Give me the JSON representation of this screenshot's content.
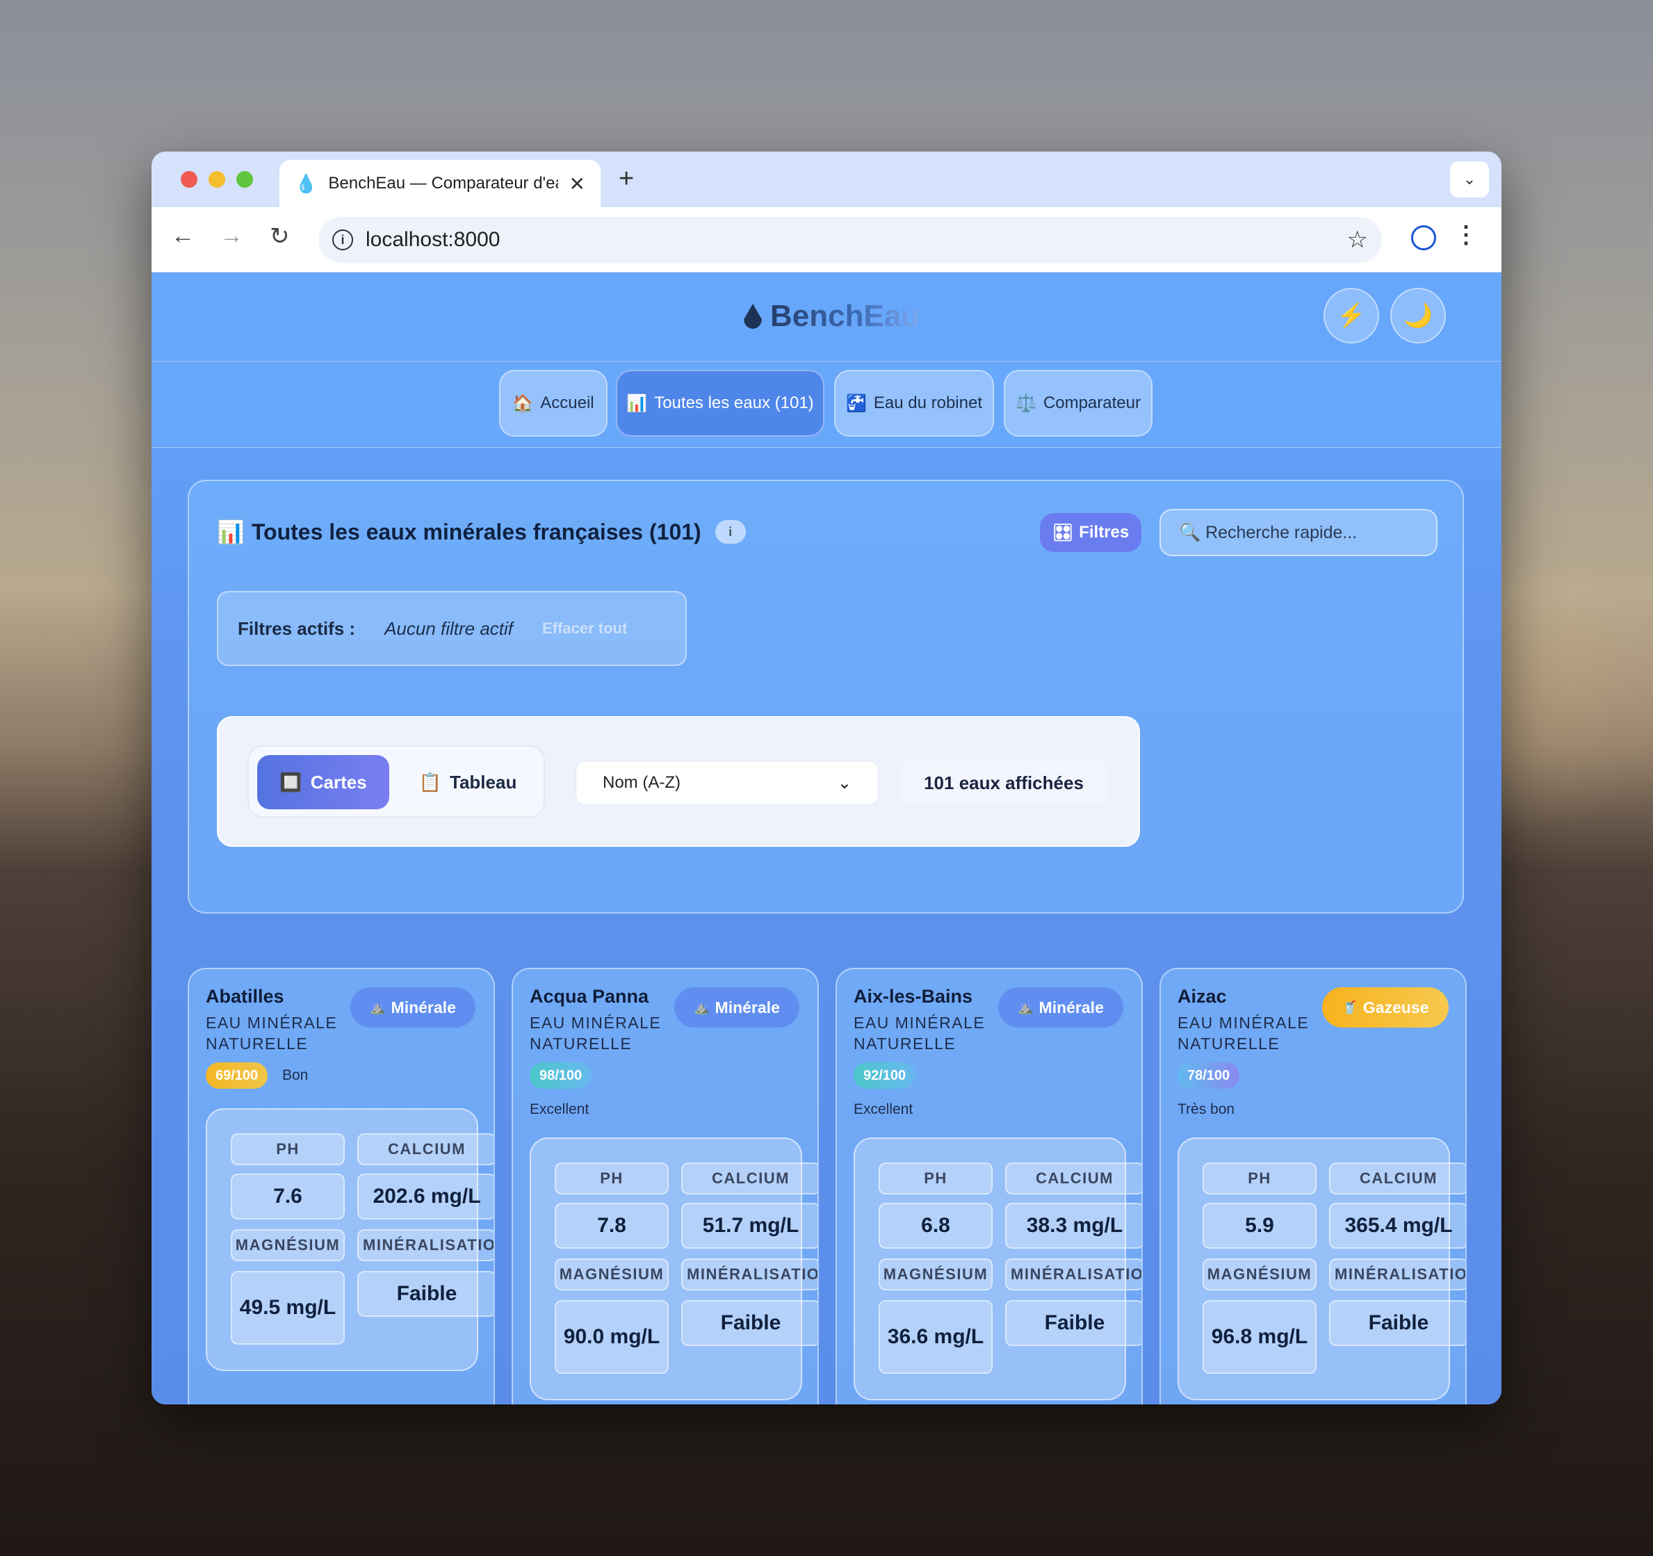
{
  "browser": {
    "tab_title": "BenchEau — Comparateur d'eaux",
    "tab_icon": "water-drop-icon",
    "url": "localhost:8000"
  },
  "header": {
    "brand": "BenchEau",
    "quick_button_icon": "⚡",
    "theme_button_icon": "🌙"
  },
  "nav": {
    "tabs": [
      {
        "icon": "🏠",
        "label": "Accueil"
      },
      {
        "icon": "📊",
        "label": "Toutes les eaux (101)"
      },
      {
        "icon": "🚰",
        "label": "Eau du robinet"
      },
      {
        "icon": "⚖️",
        "label": "Comparateur"
      }
    ],
    "active_index": 1
  },
  "panel": {
    "title_icon": "📊",
    "title": "Toutes les eaux minérales françaises (101)",
    "info_icon": "i",
    "filters_icon": "🎛",
    "filters_label": "Filtres",
    "search_placeholder": "🔍 Recherche rapide...",
    "active_filters_label": "Filtres actifs :",
    "active_filters_value": "Aucun filtre actif",
    "clear_label": "Effacer tout",
    "view_cards_icon": "🔲",
    "view_cards_label": "Cartes",
    "view_table_icon": "📋",
    "view_table_label": "Tableau",
    "sort_value": "Nom (A-Z)",
    "count_label": "101 eaux affichées"
  },
  "cards": [
    {
      "name": "Abatilles",
      "type": "EAU MINÉRALE NATURELLE",
      "badge_icon": "⛰️",
      "badge": "Minérale",
      "badge_kind": "min",
      "score": "69/100",
      "score_label": "Bon",
      "score_kind": "bon",
      "ph_label": "PH",
      "ph": "7.6",
      "calcium_label": "CALCIUM",
      "calcium": "202.6 mg/L",
      "magnesium_label": "MAGNÉSIUM",
      "magnesium": "49.5 mg/L",
      "mineral_label": "MINÉRALISATION",
      "mineral": "Faible"
    },
    {
      "name": "Acqua Panna",
      "type": "EAU MINÉRALE NATURELLE",
      "badge_icon": "⛰️",
      "badge": "Minérale",
      "badge_kind": "min",
      "score": "98/100",
      "score_label": "Excellent",
      "score_kind": "exc",
      "ph_label": "PH",
      "ph": "7.8",
      "calcium_label": "CALCIUM",
      "calcium": "51.7 mg/L",
      "magnesium_label": "MAGNÉSIUM",
      "magnesium": "90.0 mg/L",
      "mineral_label": "MINÉRALISATION",
      "mineral": "Faible"
    },
    {
      "name": "Aix-les-Bains",
      "type": "EAU MINÉRALE NATURELLE",
      "badge_icon": "⛰️",
      "badge": "Minérale",
      "badge_kind": "min",
      "score": "92/100",
      "score_label": "Excellent",
      "score_kind": "exc",
      "ph_label": "PH",
      "ph": "6.8",
      "calcium_label": "CALCIUM",
      "calcium": "38.3 mg/L",
      "magnesium_label": "MAGNÉSIUM",
      "magnesium": "36.6 mg/L",
      "mineral_label": "MINÉRALISATION",
      "mineral": "Faible"
    },
    {
      "name": "Aizac",
      "type": "EAU MINÉRALE NATURELLE",
      "badge_icon": "🥤",
      "badge": "Gazeuse",
      "badge_kind": "gaz",
      "score": "78/100",
      "score_label": "Très bon",
      "score_kind": "tb",
      "ph_label": "PH",
      "ph": "5.9",
      "calcium_label": "CALCIUM",
      "calcium": "365.4 mg/L",
      "magnesium_label": "MAGNÉSIUM",
      "magnesium": "96.8 mg/L",
      "mineral_label": "MINÉRALISATION",
      "mineral": "Faible"
    }
  ]
}
